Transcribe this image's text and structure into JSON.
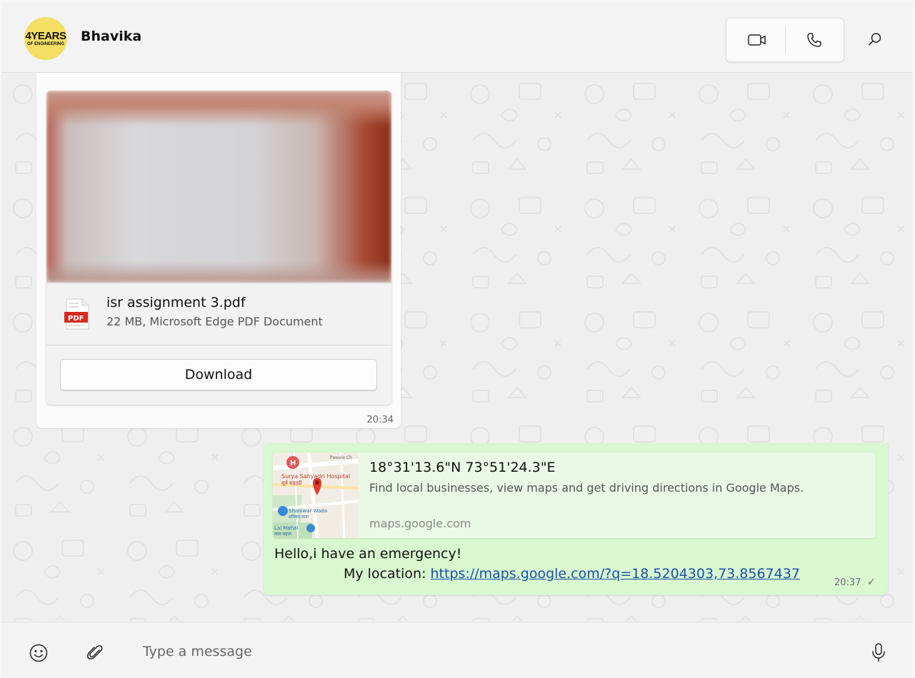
{
  "header": {
    "contact_name": "Bhavika",
    "avatar_text_top": "4YEARS",
    "avatar_text_bottom": "OF ENGINEERING",
    "video_call_icon": "video-camera-icon",
    "voice_call_icon": "phone-icon",
    "search_icon": "search-icon"
  },
  "messages": {
    "file_message": {
      "direction": "incoming",
      "file_name": "isr assignment 3.pdf",
      "file_meta": "22 MB, Microsoft Edge PDF Document",
      "file_icon_label": "PDF",
      "download_label": "Download",
      "time": "20:34"
    },
    "location_message": {
      "direction": "outgoing",
      "preview_title": "18°31'13.6\"N 73°51'24.3\"E",
      "preview_description": "Find local businesses, view maps and get driving directions in Google Maps.",
      "preview_domain": "maps.google.com",
      "map_labels": {
        "poi_1": "Surya Sahyadri Hospital",
        "poi_1_local": "सूर्य सह्याद्री",
        "poi_2": "Shaniwar Wada",
        "poi_2_local": "शनिवार वाडा",
        "poi_3": "Lal Mahal",
        "poi_3_local": "लाल महाल",
        "corner_label": "Pawale Ch"
      },
      "text_line1": "Hello,i have an emergency!",
      "text_line2_prefix": "My location: ",
      "link": "https://maps.google.com/?q=18.5204303,73.8567437",
      "time": "20:37",
      "status": "✓"
    }
  },
  "composer": {
    "placeholder": "Type a message",
    "emoji_icon": "emoji-icon",
    "attach_icon": "paperclip-icon",
    "mic_icon": "microphone-icon"
  },
  "colors": {
    "outgoing_bubble": "#d8f8d0",
    "incoming_bubble": "#fbfbfb",
    "link": "#1a4fa8",
    "chat_background": "#efefef"
  }
}
